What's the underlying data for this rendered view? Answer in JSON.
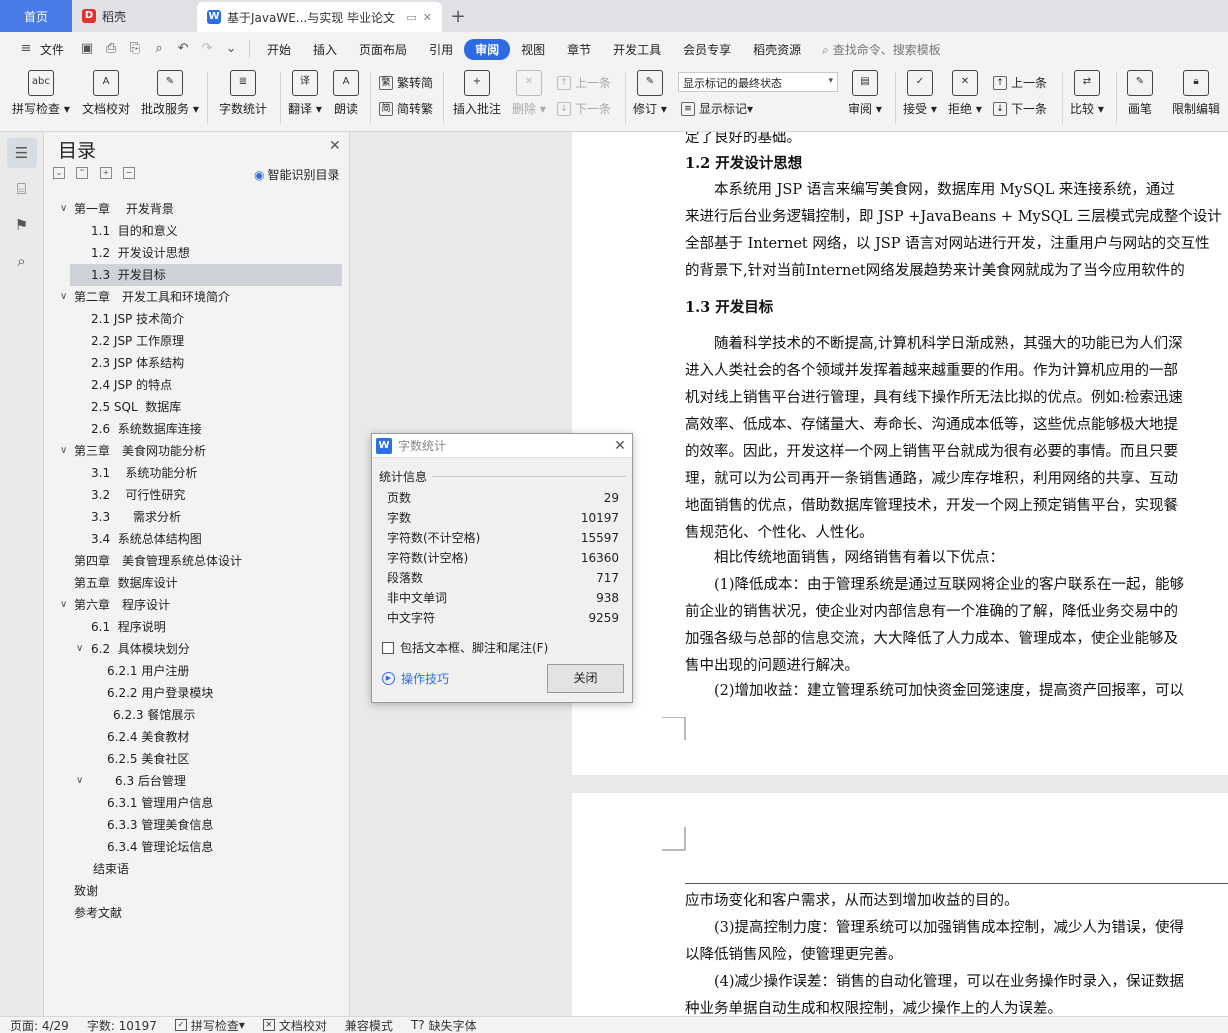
{
  "tabs": {
    "home": "首页",
    "daoke": "稻壳",
    "doc_title": "基于JavaWE...与实现 毕业论文"
  },
  "menu": {
    "file": "文件",
    "items": [
      "开始",
      "插入",
      "页面布局",
      "引用",
      "审阅",
      "视图",
      "章节",
      "开发工具",
      "会员专享",
      "稻壳资源"
    ],
    "active": "审阅",
    "search": "查找命令、搜索模板"
  },
  "ribbon": {
    "spell": "拼写检查",
    "proof": "文档校对",
    "batch": "批改服务",
    "wordcount": "字数统计",
    "translate": "翻译",
    "read": "朗读",
    "trad": "繁转简",
    "simp": "简转繁",
    "insert_comment": "插入批注",
    "delete": "删除",
    "prev": "上一条",
    "next": "下一条",
    "track": "修订",
    "markup_state": "显示标记的最终状态",
    "show_markup": "显示标记",
    "review": "审阅",
    "accept": "接受",
    "reject": "拒绝",
    "prev2": "上一条",
    "next2": "下一条",
    "compare": "比较",
    "pen": "画笔",
    "restrict": "限制编辑"
  },
  "toc": {
    "title": "目录",
    "smart": "智能识别目录",
    "items": [
      "第一章　 开发背景",
      "1.1  目的和意义",
      "1.2  开发设计思想",
      "1.3  开发目标",
      "第二章　开发工具和环境简介",
      "2.1 JSP 技术简介",
      "2.2 JSP 工作原理",
      "2.3 JSP 体系结构",
      "2.4 JSP 的特点",
      "2.5 SQL  数据库",
      "2.6  系统数据库连接",
      "第三章　美食网功能分析",
      "3.1    系统功能分析",
      "3.2    可行性研究",
      "3.3      需求分析",
      "3.4  系统总体结构图",
      "第四章　美食管理系统总体设计",
      "第五章  数据库设计",
      "第六章　程序设计",
      "6.1  程序说明",
      "6.2  具体模块划分",
      "6.2.1 用户注册",
      "6.2.2 用户登录模块",
      "6.2.3 餐馆展示",
      "6.2.4 美食教材",
      "6.2.5 美食社区",
      "6.3 后台管理",
      "6.3.1 管理用户信息",
      "6.3.3 管理美食信息",
      "6.3.4 管理论坛信息",
      "结束语",
      "致谢",
      "参考文献"
    ]
  },
  "dialog": {
    "title": "字数统计",
    "section": "统计信息",
    "stats": [
      {
        "label": "页数",
        "value": "29"
      },
      {
        "label": "字数",
        "value": "10197"
      },
      {
        "label": "字符数(不计空格)",
        "value": "15597"
      },
      {
        "label": "字符数(计空格)",
        "value": "16360"
      },
      {
        "label": "段落数",
        "value": "717"
      },
      {
        "label": "非中文单词",
        "value": "938"
      },
      {
        "label": "中文字符",
        "value": "9259"
      }
    ],
    "checkbox": "包括文本框、脚注和尾注(F)",
    "tips": "操作技巧",
    "close": "关闭"
  },
  "doc": {
    "page1": [
      "定了良好的基础。",
      "1.2  开发设计思想",
      "　　本系统用 JSP 语言来编写美食网，数据库用  MySQL 来连接系统，通过",
      "来进行后台业务逻辑控制，即 JSP +JavaBeans + MySQL 三层模式完成整个设计",
      "全部基于 Internet 网络，以 JSP 语言对网站进行开发，注重用户与网站的交互性",
      "的背景下,针对当前Internet网络发展趋势来计美食网就成为了当今应用软件的",
      "1.3  开发目标",
      "　　随着科学技术的不断提高,计算机科学日渐成熟，其强大的功能已为人们深",
      "进入人类社会的各个领域并发挥着越来越重要的作用。作为计算机应用的一部",
      "机对线上销售平台进行管理，具有线下操作所无法比拟的优点。例如:检索迅速",
      "高效率、低成本、存储量大、寿命长、沟通成本低等，这些优点能够极大地提",
      "的效率。因此，开发这样一个网上销售平台就成为很有必要的事情。而且只要",
      "理，就可以为公司再开一条销售通路，减少库存堆积，利用网络的共享、互动",
      "地面销售的优点，借助数据库管理技术，开发一个网上预定销售平台，实现餐",
      "售规范化、个性化、人性化。",
      "　　相比传统地面销售，网络销售有着以下优点：",
      "　　(1)降低成本：由于管理系统是通过互联网将企业的客户联系在一起，能够",
      "前企业的销售状况，使企业对内部信息有一个准确的了解，降低业务交易中的",
      "加强各级与总部的信息交流，大大降低了人力成本、管理成本，使企业能够及",
      "售中出现的问题进行解决。",
      "　　(2)增加收益：建立管理系统可加快资金回笼速度，提高资产回报率，可以"
    ],
    "page2": [
      "应市场变化和客户需求，从而达到增加收益的目的。",
      "　　(3)提高控制力度：管理系统可以加强销售成本控制，减少人为错误，使得",
      "以降低销售风险，使管理更完善。",
      "　　(4)减少操作误差：销售的自动化管理，可以在业务操作时录入，保证数据",
      "种业务单据自动生成和权限控制，减少操作上的人为误差。"
    ]
  },
  "status": {
    "page": "页面: 4/29",
    "words": "字数: 10197",
    "spell": "拼写检查",
    "proof": "文档校对",
    "compat": "兼容模式",
    "missing_font": "缺失字体"
  }
}
